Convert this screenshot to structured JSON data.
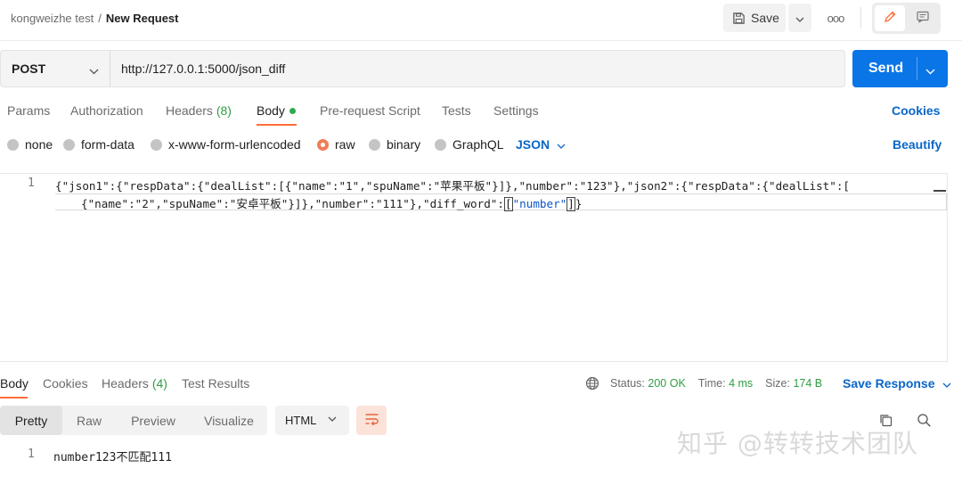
{
  "header": {
    "workspace": "kongweizhe test",
    "separator": "/",
    "request_name": "New Request",
    "save_label": "Save",
    "more_label": "ooo"
  },
  "request": {
    "method": "POST",
    "url": "http://127.0.0.1:5000/json_diff",
    "send_label": "Send"
  },
  "request_tabs": [
    {
      "label": "Params"
    },
    {
      "label": "Authorization"
    },
    {
      "label": "Headers",
      "count": "(8)"
    },
    {
      "label": "Body"
    },
    {
      "label": "Pre-request Script"
    },
    {
      "label": "Tests"
    },
    {
      "label": "Settings"
    }
  ],
  "cookies_label": "Cookies",
  "body_types": [
    {
      "label": "none"
    },
    {
      "label": "form-data"
    },
    {
      "label": "x-www-form-urlencoded"
    },
    {
      "label": "raw",
      "selected": true
    },
    {
      "label": "binary"
    },
    {
      "label": "GraphQL"
    }
  ],
  "body_format": "JSON",
  "beautify_label": "Beautify",
  "editor": {
    "line_number": "1",
    "line1": "{\"json1\":{\"respData\":{\"dealList\":[{\"name\":\"1\",\"spuName\":\"苹果平板\"}]},\"number\":\"123\"},\"json2\":{\"respData\":{\"dealList\":[",
    "line2_a": "{\"name\":\"2\",\"spuName\":\"安卓平板\"}]},\"number\":\"111\"},\"diff_word\":",
    "line2_b": "[",
    "line2_c": "\"number\"",
    "line2_d": "]",
    "line2_e": "}"
  },
  "response_tabs": [
    {
      "label": "Body"
    },
    {
      "label": "Cookies"
    },
    {
      "label": "Headers",
      "count": "(4)"
    },
    {
      "label": "Test Results"
    }
  ],
  "response_status": {
    "status_label": "Status:",
    "status_value": "200 OK",
    "time_label": "Time:",
    "time_value": "4 ms",
    "size_label": "Size:",
    "size_value": "174 B"
  },
  "save_response_label": "Save Response",
  "view_modes": [
    {
      "label": "Pretty"
    },
    {
      "label": "Raw"
    },
    {
      "label": "Preview"
    },
    {
      "label": "Visualize"
    }
  ],
  "response_format": "HTML",
  "response_body": {
    "line_number": "1",
    "text": "number123不匹配111"
  },
  "watermark": "知乎 @转转技术团队",
  "colors": {
    "accent_orange": "#ff6c37",
    "send_blue": "#0a75e6",
    "link_blue": "#0a66c8",
    "status_green": "#2f9e44"
  }
}
